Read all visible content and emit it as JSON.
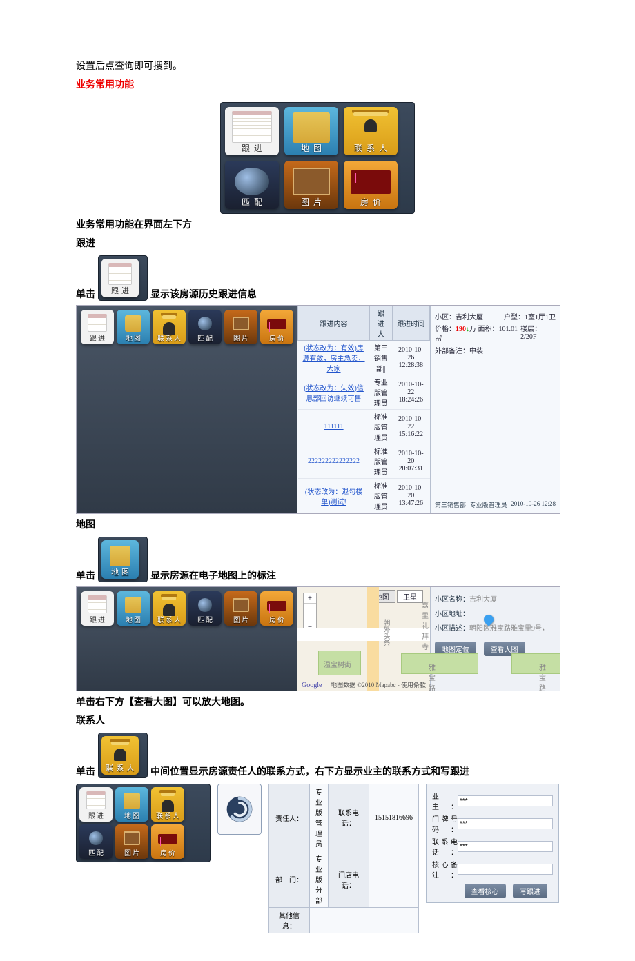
{
  "text": {
    "intro": "设置后点查询即可搜到。",
    "commonTitle": "业务常用功能",
    "commonNote": "业务常用功能在界面左下方",
    "followHeading": "跟进",
    "followPre": "单击",
    "followPost": "显示该房源历史跟进信息",
    "mapHeading": "地图",
    "mapPre": "单击",
    "mapPost": "显示房源在电子地图上的标注",
    "mapNote": "单击右下方【查看大图】可以放大地图。",
    "contactHeading": "联系人",
    "contactPre": "单击",
    "contactPost": "中间位置显示房源责任人的联系方式，右下方显示业主的联系方式和写跟进"
  },
  "tiles": {
    "follow": "跟进",
    "map": "地图",
    "contact": "联系人",
    "match": "匹配",
    "photo": "图片",
    "price": "房价"
  },
  "followTable": {
    "headers": {
      "content": "跟进内容",
      "person": "跟进人",
      "time": "跟进时间"
    },
    "rows": [
      {
        "content": "(状态改为：有效)房源有效，房主急卖，大家",
        "person": "第三销售部||",
        "time": "2010-10-26 12:28:38"
      },
      {
        "content": "(状态改为：失效)信息部回访继续可售",
        "person": "专业版管理员",
        "time": "2010-10-22 18:24:26"
      },
      {
        "content": "111111",
        "person": "标准版管理员",
        "time": "2010-10-22 15:16:22"
      },
      {
        "content": "222222222222222",
        "person": "标准版管理员",
        "time": "2010-10-20 20:07:31"
      },
      {
        "content": "(状态改为：退勾楼单)测试!",
        "person": "标准版管理员",
        "time": "2010-10-20 13:47:26"
      }
    ],
    "side": {
      "label_community": "小区：",
      "community": "吉利大厦",
      "label_huxing": "户型：",
      "huxing": "1室1厅1卫",
      "label_price": "价格：",
      "price_num": "190",
      "price_arrow": "↓",
      "price_unit": "万",
      "label_area": "面积：",
      "area": "101.01㎡",
      "label_floor": "楼层：",
      "floor": "2/20F",
      "label_memo": "外部备注：",
      "memo": "中装",
      "foot_dept": "第三销售部",
      "foot_role": "专业版管理员",
      "foot_time": "2010-10-26 12:28"
    }
  },
  "mapShot": {
    "btn_map": "地图",
    "btn_sat": "卫星",
    "place1": "嘉里礼拜寺",
    "place2": "温宝树街",
    "street1": "朝外头条",
    "street2": "雅宝路",
    "street3": "雅宝路",
    "google": "Google",
    "credit": "地图数据 ©2010 Mapabc - 使用条款",
    "side": {
      "label_name": "小区名称：",
      "name": "吉利大厦",
      "label_addr": "小区地址：",
      "addr": "",
      "label_loc": "小区描述：",
      "loc": "朝阳区雅宝路雅宝里9号，",
      "btn_locate": "地图定位",
      "btn_big": "查看大图"
    }
  },
  "contactShot": {
    "table": {
      "lab_person": "责任人：",
      "person": "专业版管理员",
      "lab_phone": "联系电话：",
      "phone": "15151816696",
      "lab_dept": "部　门：",
      "dept": "专业版分部",
      "lab_store": "门店电话：",
      "store": "",
      "lab_other": "其他信息："
    },
    "owner": {
      "lab_owner": "业　主：",
      "owner": "***",
      "lab_door": "门牌号码：",
      "door": "***",
      "lab_phone": "联系电话：",
      "phone": "***",
      "lab_memo": "核心备注：",
      "memo": "",
      "btn_view": "查看核心",
      "btn_write": "写跟进"
    }
  }
}
